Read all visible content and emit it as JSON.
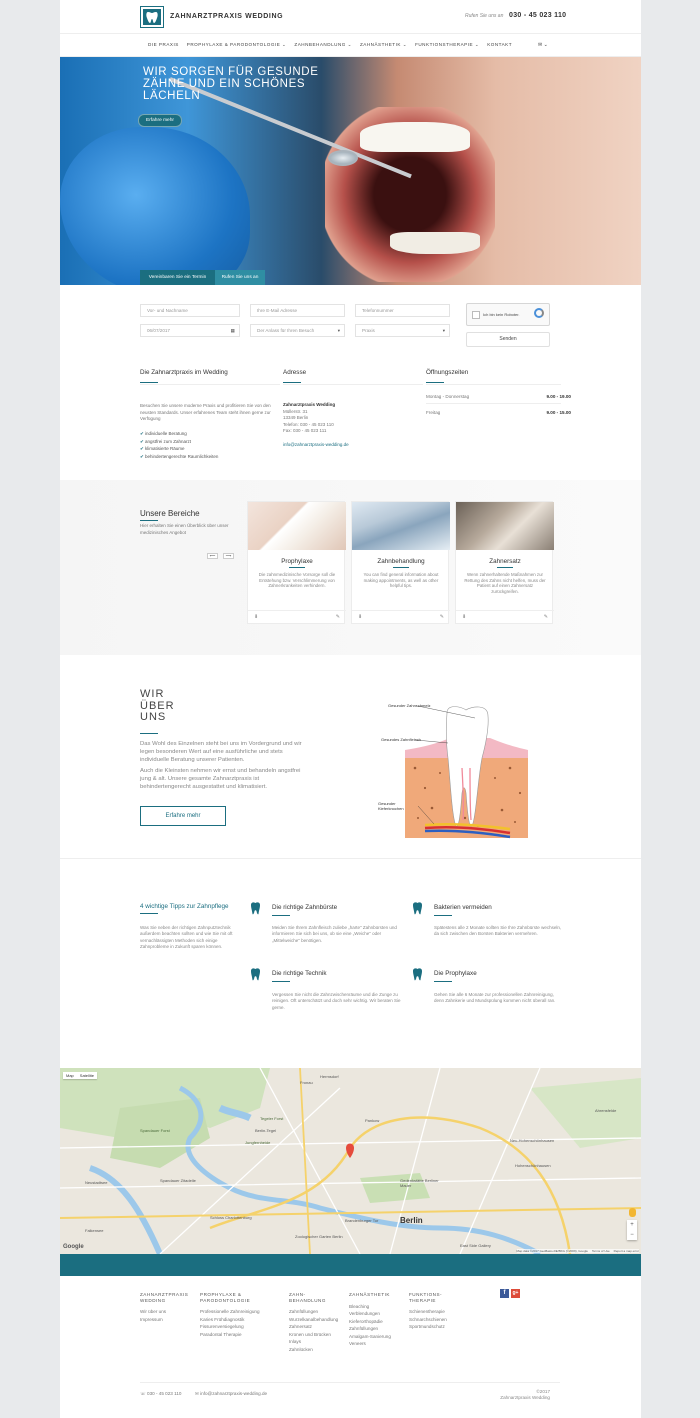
{
  "header": {
    "logo_text": "ZAHNARZTPRAXIS WEDDING",
    "call_label": "Rufen Sie uns an",
    "phone": "030 - 45 023 110"
  },
  "nav": {
    "items": [
      "Die Praxis",
      "Prophylaxe & Parodontologie ⌄",
      "Zahnbehandlung ⌄",
      "Zahnästhetik ⌄",
      "Funktionstherapie ⌄",
      "Kontakt"
    ],
    "icons": "✉ ⌄"
  },
  "hero": {
    "title": "Wir sorgen für gesunde Zähne und ein schönes Lächeln",
    "button": "Erfahre mehr",
    "tab_appointment": "Vereinbaren Sie ein Termin",
    "tab_call": "Rufen Sie uns an"
  },
  "form": {
    "name_placeholder": "Vor- und Nachname",
    "email_placeholder": "Ihre E-Mail Adresse",
    "phone_placeholder": "Telefonnummer",
    "date_value": "06/07/2017",
    "reason_value": "Der Anlass für Ihren Besuch",
    "location_value": "Praxis",
    "recaptcha_label": "Ich bin kein Roboter.",
    "send": "Senden"
  },
  "info": {
    "praxis_title": "Die Zahnarztpraxis im Wedding",
    "praxis_text": "Besuchen Sie unsere moderne Praxis und profitieren Sie von den neusten Standards. Unser erfahrenes Team steht ihnen gerne zur Verfügung",
    "checks": [
      "individuelle Beratung",
      "angstfrei zum Zahnarzt",
      "klimatisierte Räume",
      "behindertengerechte Raumlichkeiten"
    ],
    "address_title": "Adresse",
    "address_name": "Zahnarztpraxis Wedding",
    "address_street": "Müllerstr. 31",
    "address_city": "13349 Berlin",
    "address_phone": "Telefon: 030 - 45 023 110",
    "address_fax": "Fax: 030 - 45 023 111",
    "address_email": "info@zahnarztpraxis-wedding.de",
    "hours_title": "Öffnungszeiten",
    "hours": [
      {
        "day": "Montag - Donnerstag",
        "time": "9.00 - 19.00"
      },
      {
        "day": "Freitag",
        "time": "9.00 - 15.00"
      }
    ]
  },
  "bereiche": {
    "title": "Unsere Bereiche",
    "subtitle": "Hier erhalten Sie einen Überblick über unser medizinisches Angebot",
    "prev": "⟵",
    "next": "⟶",
    "cards": [
      {
        "title": "Prophylaxe",
        "text": "Die zahnmedizinische Vorsorge soll die Entstehung bzw. Verschlimmerung von Zahnerkrankeiten verhindern."
      },
      {
        "title": "Zahnbehandlung",
        "text": "You can find general information about making appointments, as well as other helpful tips."
      },
      {
        "title": "Zahnersatz",
        "text": "Wenn zahnerhaltende Maßnahmen zur Rettung des Zahns nicht helfen, muss der Patient auf einen Zahnersatz zurückgreifen."
      }
    ],
    "card_footer_left": "⬇",
    "card_footer_right": "✎"
  },
  "about": {
    "title_1": "Wir",
    "title_2": "über",
    "title_3": "uns",
    "text_1": "Das Wohl des Einzelnen steht bei uns im Vordergrund und wir legen besonderen Wert auf eine ausführliche und stets individuelle Beratung unserer Patienten.",
    "text_2": "Auch die Kleinsten nehmen wir ernst und behandeln angstfrei jung & alt. Unsere gesamte Zahnarztpraxis ist behindertengerecht ausgestattet und klimatisiert.",
    "button": "Erfahre mehr",
    "diagram_labels": [
      "Gesunder Zahnschmelz",
      "Gesundes Zahnfleisch",
      "Gesunder Kieferknochen"
    ]
  },
  "tips": {
    "title": "4 wichtige Tipps zur Zahnpflege",
    "intro": "Was Sie neben der richtigen Zahnputztechnik außerdem beachten sollten und wie Sie mit oft vernachlässigten Methoden sich einige Zahnprobleme in Zukunft sparen können.",
    "items": [
      {
        "title": "Die richtige Zahnbürste",
        "text": "Meiden Sie Ihrem Zahnfleisch zuliebe „harte\" Zahnbürsten und informieren Sie sich bei uns, ob sie eine „Weiche\" oder „Mittelweiche\" benötigen."
      },
      {
        "title": "Bakterien vermeiden",
        "text": "Spätestens alle 2 Monate sollten Sie Ihre Zahnbürste wechseln, da sich zwischen den Borsten Bakterien vermehren."
      },
      {
        "title": "Die richtige Technik",
        "text": "Vergessen Sie nicht die Zahnzwischenräume und die Zunge zu reinigen. Oft unterschätzt und doch sehr wichtig. Wir beraten Sie gerne."
      },
      {
        "title": "Die Prophylaxe",
        "text": "Gehen Sie alle 6 Monate zur professionellen Zahnreinigung, denn Zahnkerie und Mundspülung kommen nicht überall ran."
      }
    ]
  },
  "map": {
    "tab_map": "Map",
    "tab_sat": "Satellite",
    "labels": [
      "Tegeler Forst",
      "Spandauer Forst",
      "Hermsdorf",
      "Berlin-Tegel",
      "Jungfernheide",
      "Spandauer Zitadelle",
      "Schloss Charlottenburg",
      "Gedenkstätte Berliner Mauer",
      "Brandenburger Tor",
      "Berlin",
      "Hohenschönhausen",
      "Ahrensfelde",
      "Neu-Hohenschönhausen",
      "East Side Gallery",
      "Zoologischer Garten Berlin",
      "Falkensee",
      "Neustadtsee",
      "Fronau",
      "Pankow"
    ],
    "attribution": "Map data ©2017 GeoBasis-DE/BKG (©2009), Google",
    "terms": "Terms of Use",
    "report": "Report a map error",
    "google": "Google",
    "zoom_in": "+",
    "zoom_out": "−"
  },
  "footer": {
    "cols": [
      {
        "heading": "Zahnarztpraxis Wedding",
        "items": [
          "Wir über uns",
          "Impressum"
        ]
      },
      {
        "heading": "Prophylaxe & Parodontologie",
        "items": [
          "Professionelle Zahnreinigung",
          "Karies Frühdiagnostik",
          "Fissurenversiegelung",
          "Paradontal Therapie"
        ]
      },
      {
        "heading": "Zahn-behandlung",
        "items": [
          "Zahnfüllungen",
          "Wurzelkanalbehandlung",
          "Zahnersatz",
          "Kronen und Brücken",
          "Inlays",
          "Zahnlücken"
        ]
      },
      {
        "heading": "Zahnästhetik",
        "items": [
          "Bleaching",
          "Verblendungen",
          "Kieferorthopädie",
          "Zahnfüllungen",
          "Amalgam-Sanierung",
          "Veneers"
        ]
      },
      {
        "heading": "Funktions-therapie",
        "items": [
          "Schienentherapie",
          "Schnarchschienen",
          "Sportmundschutz"
        ]
      }
    ],
    "social_fb": "f",
    "social_gp": "g+",
    "phone": "030 - 45 023 110",
    "email": "info@zahnarztpraxis-wedding.de",
    "copyright_1": "©2017",
    "copyright_2": "Zahnarztpraxis Wedding"
  },
  "colors": {
    "accent": "#1b6e80",
    "check": "#1b6e80"
  }
}
